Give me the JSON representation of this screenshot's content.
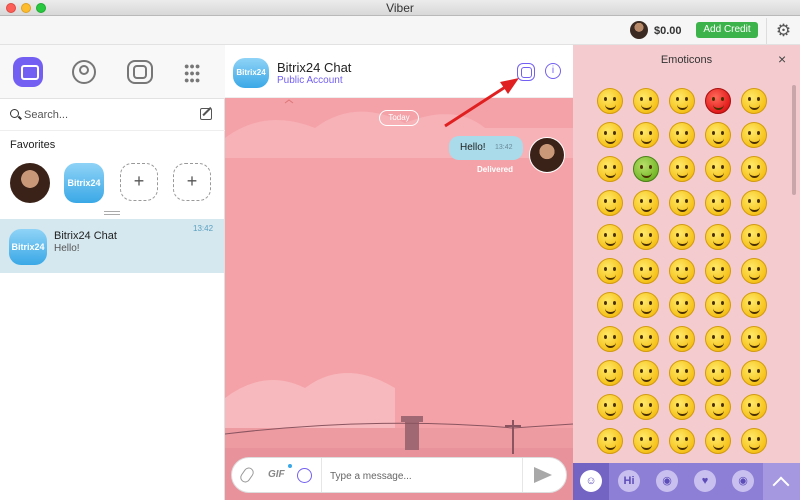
{
  "window": {
    "title": "Viber"
  },
  "topbar": {
    "balance": "$0.00",
    "credit_label": "Add Credit"
  },
  "sidebar": {
    "search_placeholder": "Search...",
    "favorites_title": "Favorites",
    "chats": [
      {
        "name": "Bitrix24 Chat",
        "preview": "Hello!",
        "time": "13:42",
        "avatar_text": "Bitrix24"
      }
    ]
  },
  "chat": {
    "name": "Bitrix24 Chat",
    "subtitle": "Public Account",
    "avatar_text": "Bitrix24",
    "date_divider": "Today",
    "messages": [
      {
        "text": "Hello!",
        "time": "13:42",
        "status": "Delivered"
      }
    ],
    "composer": {
      "gif_label": "GIF",
      "placeholder": "Type a message..."
    }
  },
  "emoticons": {
    "title": "Emoticons",
    "close": "×",
    "tabs": [
      {
        "name": "smile",
        "glyph": "☺",
        "selected": true
      },
      {
        "name": "hi",
        "glyph": "Hi",
        "selected": false
      },
      {
        "name": "cat",
        "glyph": "◉",
        "selected": false
      },
      {
        "name": "heart",
        "glyph": "♥",
        "selected": false
      },
      {
        "name": "dog",
        "glyph": "◉",
        "selected": false
      }
    ]
  },
  "colors": {
    "viber_purple": "#7360f2",
    "credit_green": "#3cb44b",
    "chat_background": "#f4a2a8",
    "bubble": "#a9dbea",
    "emoticon_panel": "#f4cccf",
    "annotation_arrow": "#e02020"
  }
}
